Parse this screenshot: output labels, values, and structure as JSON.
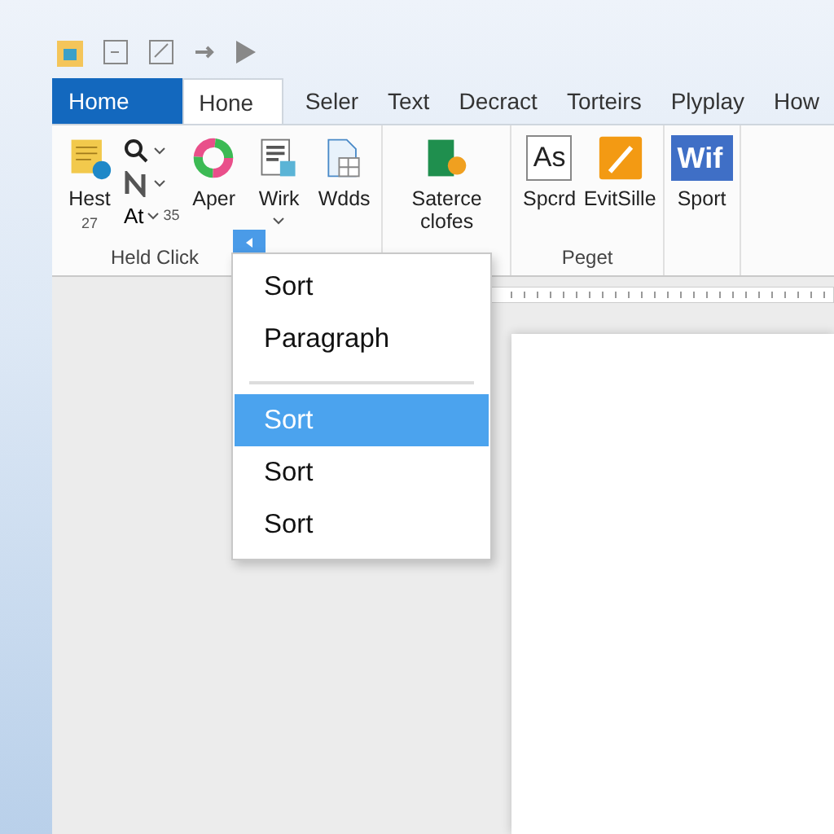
{
  "tabs": [
    {
      "label": "Home",
      "kind": "file",
      "selected": false
    },
    {
      "label": "Hone",
      "kind": "tab",
      "selected": true
    },
    {
      "label": "Seler",
      "kind": "tab",
      "selected": false
    },
    {
      "label": "Text",
      "kind": "tab",
      "selected": false
    },
    {
      "label": "Decract",
      "kind": "tab",
      "selected": false
    },
    {
      "label": "Torteirs",
      "kind": "tab",
      "selected": false
    },
    {
      "label": "Plyplay",
      "kind": "tab",
      "selected": false
    },
    {
      "label": "How",
      "kind": "tab",
      "selected": false
    }
  ],
  "ribbon": {
    "groups": [
      {
        "label": "Held Click",
        "items": [
          {
            "kind": "large",
            "label": "Hest",
            "sub": "27"
          },
          {
            "kind": "stack",
            "rows": [
              "",
              "",
              "At"
            ],
            "note": "35"
          },
          {
            "kind": "large",
            "label": "Aper"
          },
          {
            "kind": "large",
            "label": "Wirk"
          },
          {
            "kind": "large",
            "label": "Wdds"
          }
        ]
      },
      {
        "items": [
          {
            "kind": "large",
            "label": "Saterce clofes"
          }
        ]
      },
      {
        "label": "Peget",
        "items": [
          {
            "kind": "large",
            "label": "Spcrd",
            "badge": "As"
          },
          {
            "kind": "large",
            "label": "EvitSille"
          }
        ]
      },
      {
        "items": [
          {
            "kind": "large",
            "label": "Sport",
            "badge": "Wif"
          }
        ]
      }
    ]
  },
  "menu": {
    "items": [
      {
        "kind": "item",
        "label": "Sort",
        "selected": false
      },
      {
        "kind": "item",
        "label": "Paragraph",
        "selected": false
      },
      {
        "kind": "separator"
      },
      {
        "kind": "item",
        "label": "Sort",
        "selected": true
      },
      {
        "kind": "item",
        "label": "Sort",
        "selected": false
      },
      {
        "kind": "item",
        "label": "Sort",
        "selected": false
      }
    ]
  }
}
